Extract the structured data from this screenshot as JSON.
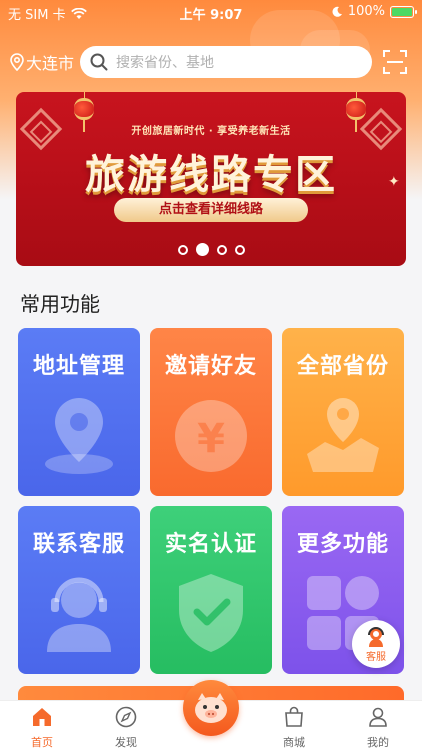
{
  "status_bar": {
    "carrier": "无 SIM 卡",
    "time": "上午 9:07",
    "battery": "100%"
  },
  "header": {
    "city": "大连市",
    "search_placeholder": "搜索省份、基地"
  },
  "banner": {
    "subline": "开创旅居新时代 · 享受养老新生活",
    "headline": "旅游线路专区",
    "button_text": "点击查看详细线路",
    "slide_count": 4,
    "active_slide": 2
  },
  "section": {
    "title": "常用功能"
  },
  "features": [
    {
      "label": "地址管理",
      "icon": "location-pin-icon",
      "color": "#5b7cf5"
    },
    {
      "label": "邀请好友",
      "icon": "yen-coin-icon",
      "color": "#ff8547"
    },
    {
      "label": "全部省份",
      "icon": "map-icon",
      "color": "#ffb24a"
    },
    {
      "label": "联系客服",
      "icon": "headset-icon",
      "color": "#5b7cf5"
    },
    {
      "label": "实名认证",
      "icon": "shield-check-icon",
      "color": "#3ed07a"
    },
    {
      "label": "更多功能",
      "icon": "grid-icon",
      "color": "#9a68f3"
    }
  ],
  "floating_service": {
    "label": "客服"
  },
  "tabbar": {
    "home": "首页",
    "discover": "发现",
    "mall": "商城",
    "mine": "我的"
  },
  "colors": {
    "accent": "#f56a2c",
    "banner_red": "#c8141e"
  }
}
